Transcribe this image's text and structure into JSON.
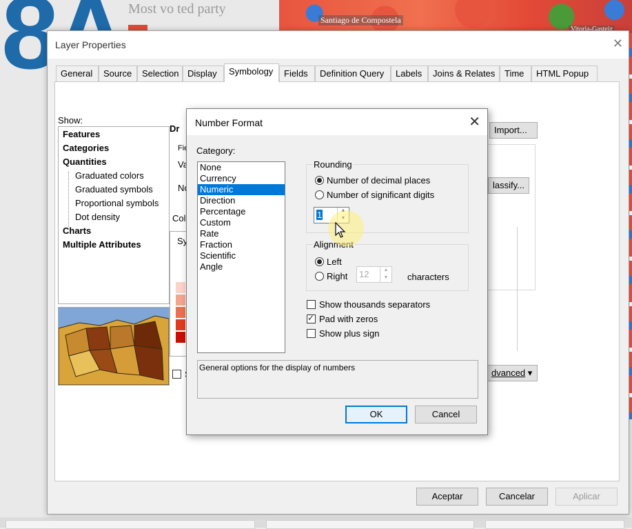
{
  "background": {
    "big_number": "8A",
    "top_text": "Most vo ted party",
    "map_labels": [
      "Santiago de Compostela",
      "Vitoria-Gasteiz"
    ]
  },
  "window": {
    "title": "Layer Properties",
    "tabs": [
      {
        "label": "General"
      },
      {
        "label": "Source"
      },
      {
        "label": "Selection"
      },
      {
        "label": "Display"
      },
      {
        "label": "Symbology",
        "active": true
      },
      {
        "label": "Fields"
      },
      {
        "label": "Definition Query"
      },
      {
        "label": "Labels"
      },
      {
        "label": "Joins & Relates"
      },
      {
        "label": "Time"
      },
      {
        "label": "HTML Popup"
      }
    ],
    "show_label": "Show:",
    "tree": {
      "features": "Features",
      "categories": "Categories",
      "quantities": "Quantities",
      "graduated_colors": "Graduated colors",
      "graduated_symbols": "Graduated symbols",
      "proportional_symbols": "Proportional symbols",
      "dot_density": "Dot density",
      "charts": "Charts",
      "multiple_attributes": "Multiple Attributes"
    },
    "partial_labels": {
      "dr": "Dr",
      "fie": "Fie",
      "va": "Va",
      "no": "No",
      "col": "Col",
      "sy": "Sy",
      "s": "S"
    },
    "import_button": "Import...",
    "classify_button": "lassify...",
    "advanced_button": "dvanced",
    "ramp_colors": [
      "#fbd3c8",
      "#f5a58f",
      "#ee6e52",
      "#e23a20",
      "#c80f00"
    ],
    "buttons": {
      "accept": "Aceptar",
      "cancel": "Cancelar",
      "apply": "Aplicar"
    }
  },
  "dialog": {
    "title": "Number Format",
    "category_label": "Category:",
    "categories": [
      "None",
      "Currency",
      "Numeric",
      "Direction",
      "Percentage",
      "Custom",
      "Rate",
      "Fraction",
      "Scientific",
      "Angle"
    ],
    "selected_category": "Numeric",
    "rounding": {
      "label": "Rounding",
      "decimal_places": "Number of decimal places",
      "significant_digits": "Number of significant digits",
      "value": "1"
    },
    "alignment": {
      "label": "Alignment",
      "left": "Left",
      "right": "Right",
      "characters_value": "12",
      "characters_label": "characters"
    },
    "options": {
      "thousands": "Show thousands separators",
      "pad_zeros": "Pad with zeros",
      "plus_sign": "Show plus sign"
    },
    "description": "General options for the display of numbers",
    "ok": "OK",
    "cancel": "Cancel"
  }
}
